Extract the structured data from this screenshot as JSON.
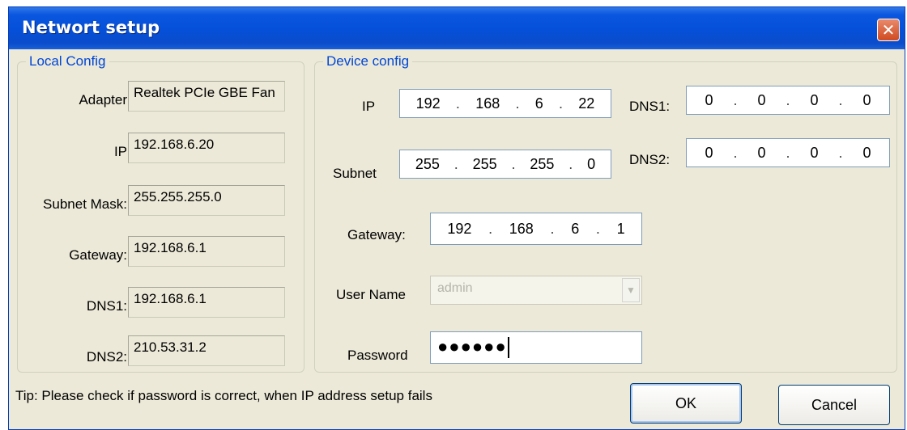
{
  "window": {
    "title": "Networt setup",
    "close_glyph": "✕"
  },
  "local_config": {
    "legend": "Local Config",
    "fields": [
      {
        "label": "Adapter",
        "value": "Realtek PCIe GBE Fan"
      },
      {
        "label": "IP",
        "value": "192.168.6.20"
      },
      {
        "label": "Subnet Mask:",
        "value": "255.255.255.0"
      },
      {
        "label": "Gateway:",
        "value": "192.168.6.1"
      },
      {
        "label": "DNS1:",
        "value": "192.168.6.1"
      },
      {
        "label": "DNS2:",
        "value": "210.53.31.2"
      }
    ]
  },
  "device_config": {
    "legend": "Device config",
    "ip": {
      "label": "IP",
      "octets": [
        "192",
        "168",
        "6",
        "22"
      ]
    },
    "subnet": {
      "label": "Subnet",
      "octets": [
        "255",
        "255",
        "255",
        "0"
      ]
    },
    "gateway": {
      "label": "Gateway:",
      "octets": [
        "192",
        "168",
        "6",
        "1"
      ]
    },
    "dns1": {
      "label": "DNS1:",
      "octets": [
        "0",
        "0",
        "0",
        "0"
      ]
    },
    "dns2": {
      "label": "DNS2:",
      "octets": [
        "0",
        "0",
        "0",
        "0"
      ]
    },
    "username": {
      "label": "User Name",
      "value": "admin",
      "icon": "chevron-down-icon"
    },
    "password": {
      "label": "Password",
      "value": "●●●●●●"
    }
  },
  "tip": "Tip:  Please check if password is correct, when IP address setup fails",
  "buttons": {
    "ok": "OK",
    "cancel": "Cancel"
  },
  "colors": {
    "title_bar": "#0550d8",
    "dialog_bg": "#ece9d8",
    "legend_text": "#0046d5",
    "close_button": "#d04a20"
  }
}
